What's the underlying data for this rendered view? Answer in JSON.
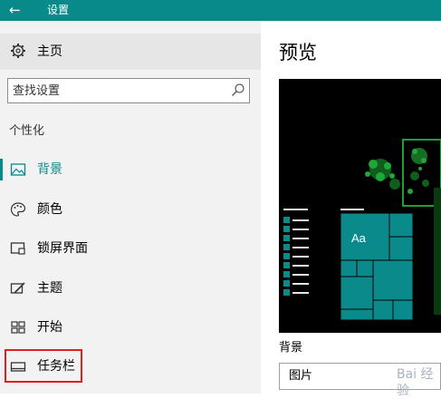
{
  "titlebar": {
    "title": "设置",
    "back_icon": "arrow-left-icon"
  },
  "sidebar": {
    "home_label": "主页",
    "search_placeholder": "查找设置",
    "section_label": "个性化",
    "items": [
      {
        "label": "背景",
        "icon": "picture-icon",
        "active": true
      },
      {
        "label": "颜色",
        "icon": "palette-icon",
        "active": false
      },
      {
        "label": "锁屏界面",
        "icon": "lock-screen-icon",
        "active": false
      },
      {
        "label": "主题",
        "icon": "theme-icon",
        "active": false
      },
      {
        "label": "开始",
        "icon": "start-icon",
        "active": false
      },
      {
        "label": "任务栏",
        "icon": "taskbar-icon",
        "active": false
      }
    ]
  },
  "main": {
    "preview_title": "预览",
    "tile_text": "Aa",
    "background_label": "背景",
    "background_value": "图片"
  },
  "watermark": "Bai 经验",
  "colors": {
    "accent": "#088a8a",
    "highlight": "#e01e1e",
    "sidebar_bg": "#f2f2f2"
  }
}
